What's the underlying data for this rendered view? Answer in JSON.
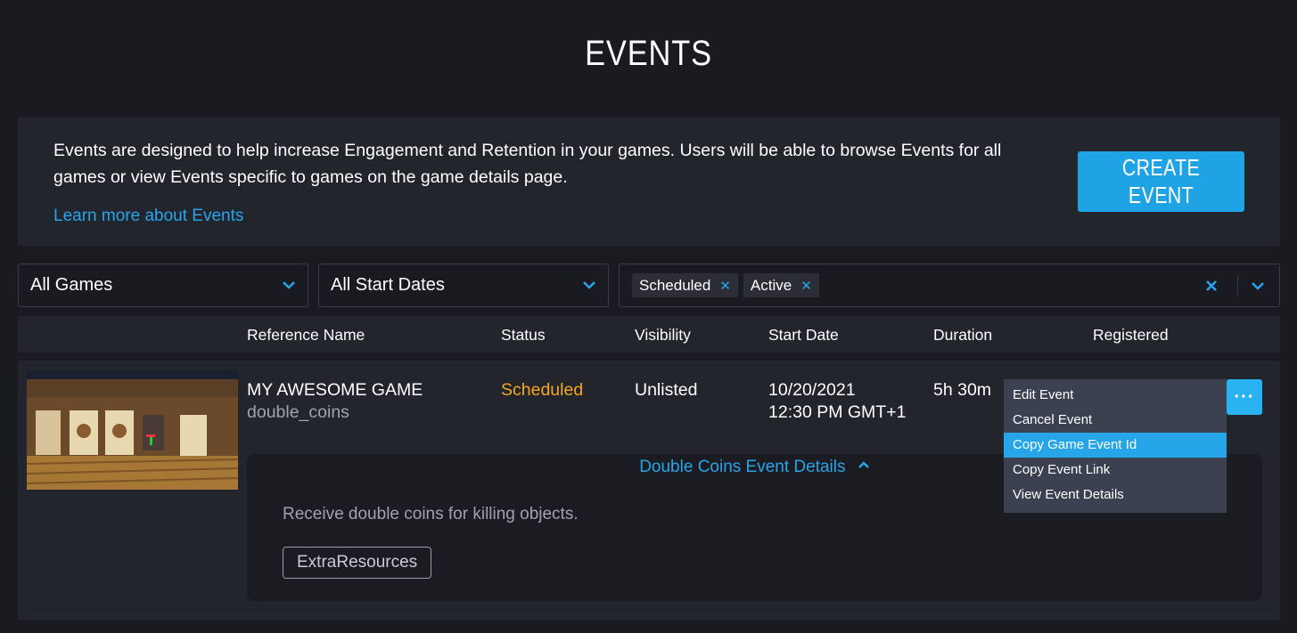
{
  "page": {
    "title": "EVENTS"
  },
  "intro": {
    "text": "Events are designed to help increase Engagement and Retention in your games. Users will be able to browse Events for all games or view Events specific to games on the game details page.",
    "learn_more": "Learn more about Events",
    "create_button": "CREATE EVENT"
  },
  "filters": {
    "games": "All Games",
    "dates": "All Start Dates",
    "status_chips": [
      "Scheduled",
      "Active"
    ]
  },
  "columns": [
    "Reference Name",
    "Status",
    "Visibility",
    "Start Date",
    "Duration",
    "Registered"
  ],
  "event": {
    "name": "MY AWESOME GAME",
    "ref": "double_coins",
    "status": "Scheduled",
    "visibility": "Unlisted",
    "start_date": "10/20/2021",
    "start_time": "12:30 PM GMT+1",
    "duration": "5h 30m",
    "details_toggle": "Double Coins Event Details",
    "description": "Receive double coins for killing objects.",
    "tag": "ExtraResources",
    "more_label": "···"
  },
  "menu": {
    "items": [
      "Edit Event",
      "Cancel Event",
      "Copy Game Event Id",
      "Copy Event Link",
      "View Event Details"
    ],
    "active_index": 2
  },
  "colors": {
    "accent": "#27a4ec",
    "status_scheduled": "#f5a623",
    "background": "#191b20",
    "panel": "#22252c"
  }
}
